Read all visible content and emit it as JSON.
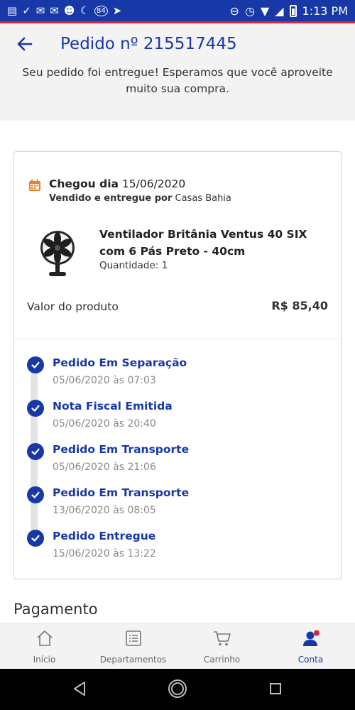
{
  "status_bar": {
    "time": "1:13 PM",
    "badge_count": "84",
    "colors": {
      "background": "#1838a8"
    }
  },
  "header": {
    "title": "Pedido nº 215517445",
    "subtitle": "Seu pedido foi entregue! Esperamos que você aproveite muito sua compra."
  },
  "order": {
    "arrival_prefix": "Chegou dia",
    "arrival_date": "15/06/2020",
    "seller_prefix": "Vendido e entregue por",
    "seller_name": "Casas Bahia",
    "product_name": "Ventilador Britânia Ventus 40 SIX com 6 Pás Preto - 40cm",
    "quantity": "Quantidade: 1",
    "price_label": "Valor do produto",
    "price_value": "R$ 85,40"
  },
  "timeline": [
    {
      "label": "Pedido Em Separação",
      "time": "05/06/2020 às 07:03"
    },
    {
      "label": "Nota Fiscal Emitida",
      "time": "05/06/2020 às 20:40"
    },
    {
      "label": "Pedido Em Transporte",
      "time": "05/06/2020 às 21:06"
    },
    {
      "label": "Pedido Em Transporte",
      "time": "13/06/2020 às 08:05"
    },
    {
      "label": "Pedido Entregue",
      "time": "15/06/2020 às 13:22"
    }
  ],
  "payment_heading": "Pagamento",
  "bottom_nav": [
    {
      "label": "Início",
      "icon": "home-icon"
    },
    {
      "label": "Departamentos",
      "icon": "list-icon"
    },
    {
      "label": "Carrinho",
      "icon": "cart-icon"
    },
    {
      "label": "Conta",
      "icon": "account-icon",
      "active": true
    }
  ],
  "colors": {
    "primary": "#1838a8",
    "accent_red": "#d7263d",
    "calendar_orange": "#e8822a"
  }
}
